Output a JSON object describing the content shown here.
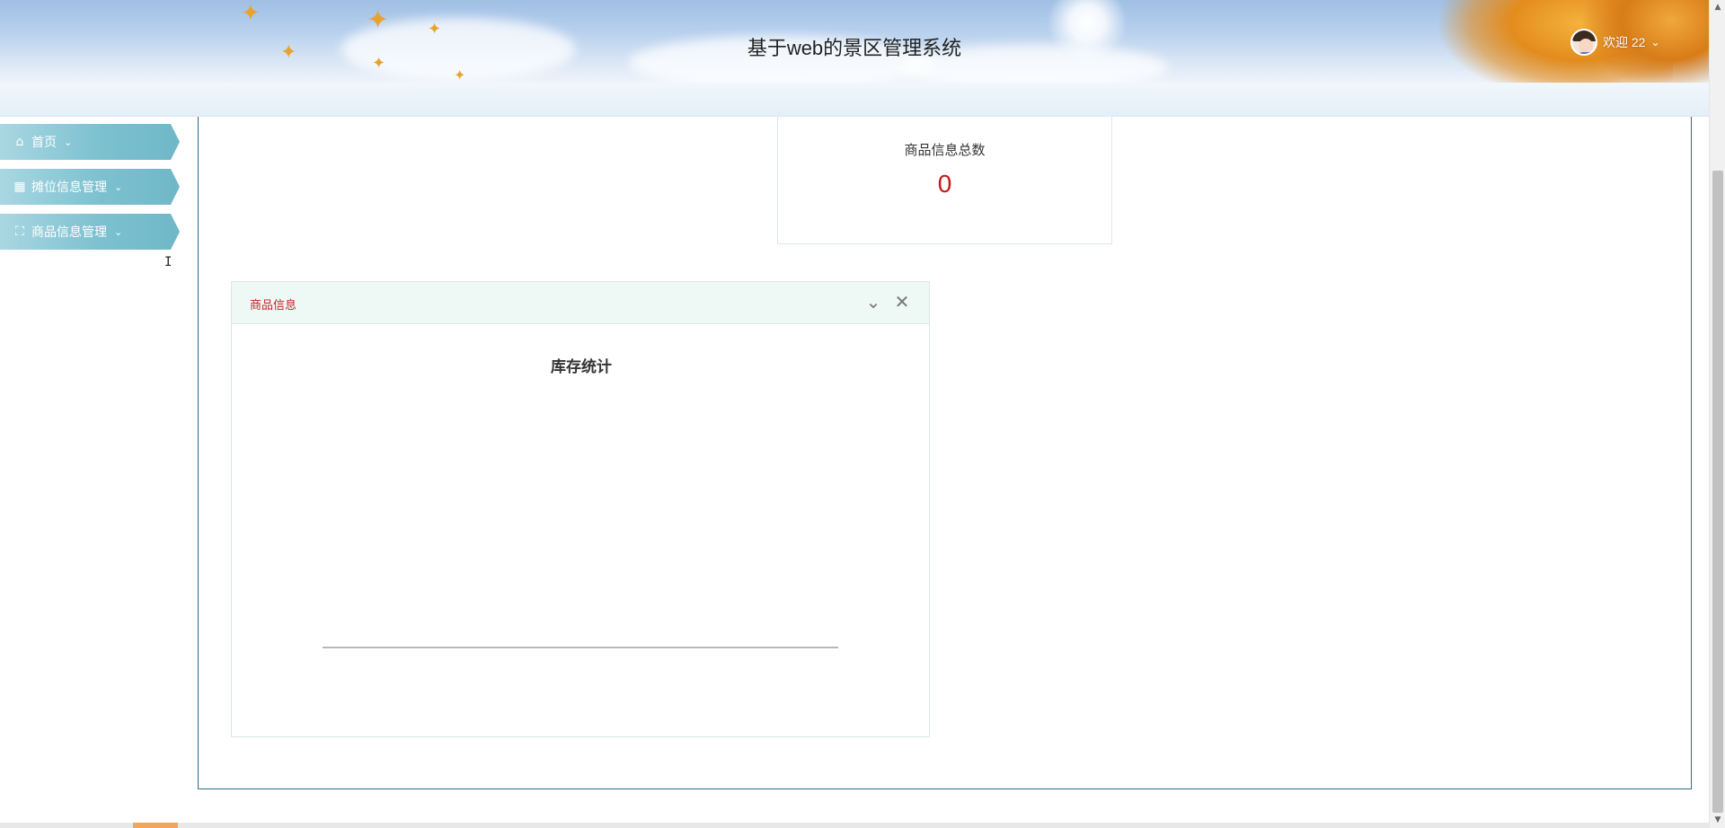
{
  "header": {
    "title": "基于web的景区管理系统",
    "user_label": "欢迎 22",
    "user_caret": "⌄"
  },
  "sidebar": {
    "items": [
      {
        "label": "首页",
        "icon": "home-icon",
        "glyph": "⌂",
        "caret": "⌄"
      },
      {
        "label": "摊位信息管理",
        "icon": "grid-icon",
        "glyph": "▦",
        "caret": "⌄"
      },
      {
        "label": "商品信息管理",
        "icon": "crop-icon",
        "glyph": "⛶",
        "caret": "⌄"
      }
    ]
  },
  "stat_card": {
    "label": "商品信息总数",
    "value": "0"
  },
  "panel": {
    "title": "商品信息",
    "collapse_glyph": "⌄",
    "close_glyph": "✕"
  },
  "chart_data": {
    "type": "bar",
    "title": "库存统计",
    "categories": [],
    "values": [],
    "xlabel": "",
    "ylabel": ""
  },
  "scrollbar": {
    "up_glyph": "▲",
    "down_glyph": "▼"
  },
  "colors": {
    "accent_red": "#c21a1a",
    "panel_title_red": "#c8232c",
    "nav_teal": "#7dc1d0",
    "frame_blue": "#2e6a8c"
  }
}
